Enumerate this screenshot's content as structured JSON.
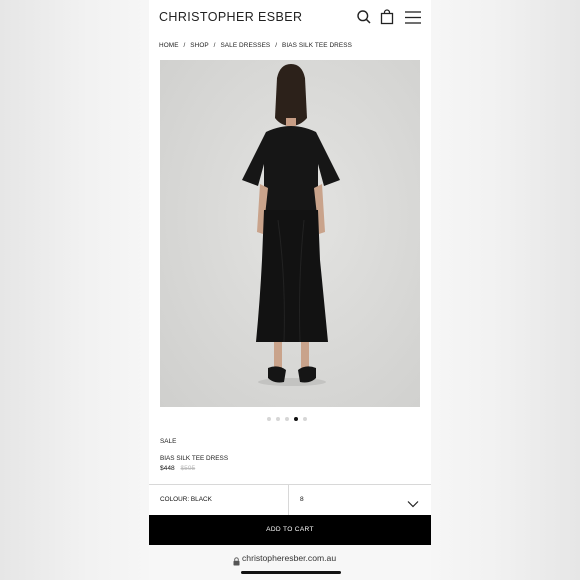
{
  "header": {
    "logo": "CHRISTOPHER ESBER",
    "icons": [
      "search-icon",
      "bag-icon",
      "menu-icon"
    ]
  },
  "breadcrumb": {
    "items": [
      "HOME",
      "SHOP",
      "SALE DRESSES",
      "BIAS SILK TEE DRESS"
    ],
    "separator": "/"
  },
  "gallery": {
    "image_count": 5,
    "active_index": 3
  },
  "product": {
    "badge": "SALE",
    "name": "BIAS SILK TEE DRESS",
    "price_now": "$448",
    "price_was": "$595"
  },
  "options": {
    "colour_label": "COLOUR: BLACK",
    "size_value": "8"
  },
  "cart": {
    "button_label": "ADD TO CART"
  },
  "browser": {
    "url": "christopheresber.com.au"
  },
  "colors": {
    "accent": "#000000",
    "background": "#ffffff",
    "muted": "#bbbbbb"
  }
}
